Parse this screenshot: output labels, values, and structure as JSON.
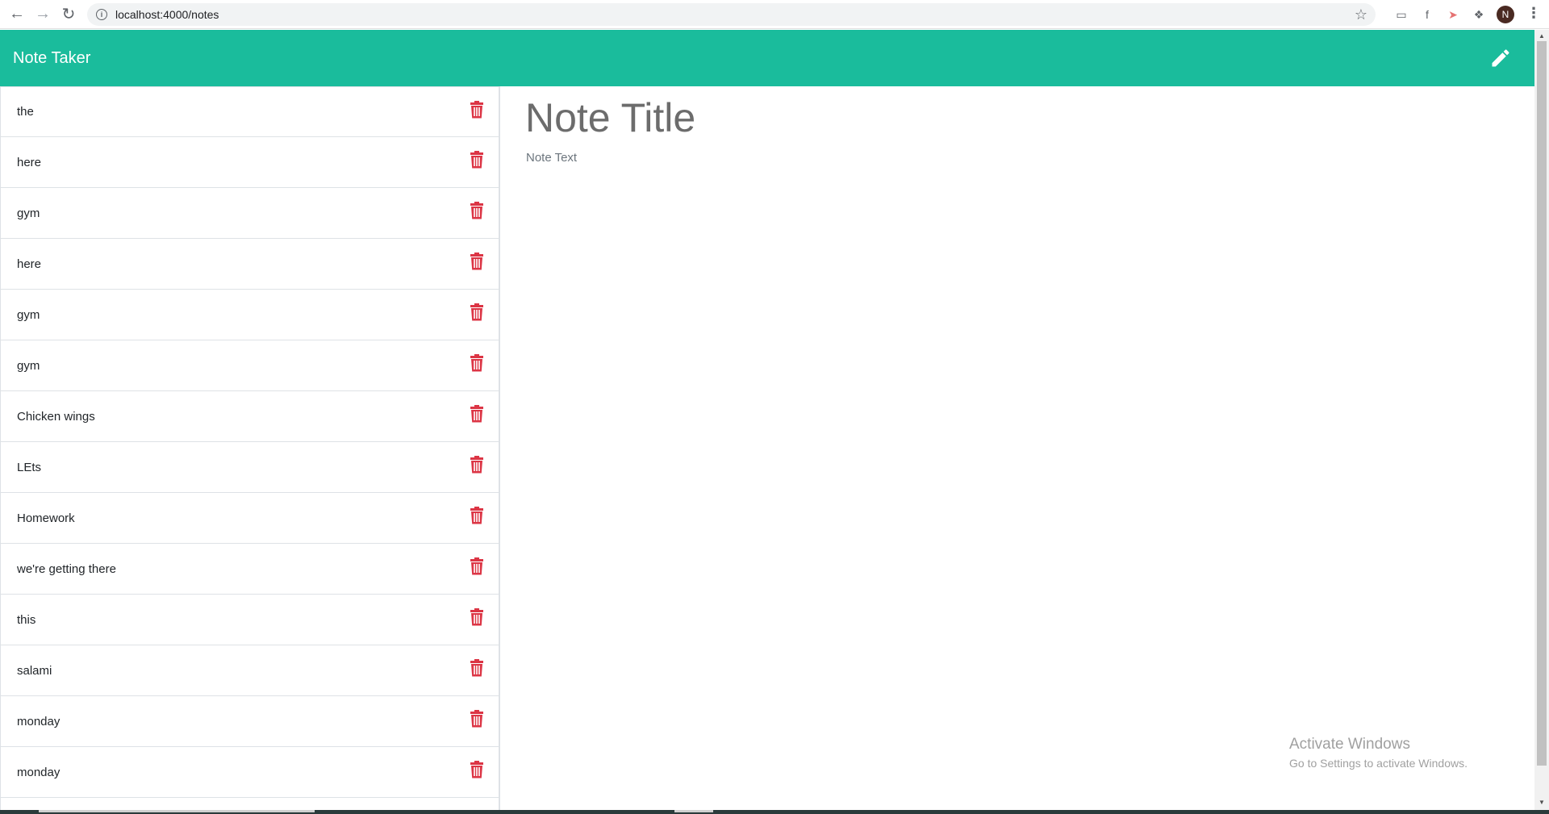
{
  "browser": {
    "url": "localhost:4000/notes",
    "back_icon": "arrow-left-icon",
    "forward_icon": "arrow-right-icon",
    "reload_icon": "reload-icon",
    "avatar_letter": "N"
  },
  "app": {
    "brand": "Note Taker",
    "accent_color": "#1abc9c",
    "delete_color": "#dc3545"
  },
  "notes": [
    {
      "title": "the"
    },
    {
      "title": "here"
    },
    {
      "title": "gym"
    },
    {
      "title": "here"
    },
    {
      "title": "gym"
    },
    {
      "title": "gym"
    },
    {
      "title": "Chicken wings"
    },
    {
      "title": "LEts"
    },
    {
      "title": "Homework"
    },
    {
      "title": "we're getting there"
    },
    {
      "title": "this"
    },
    {
      "title": "salami"
    },
    {
      "title": "monday"
    },
    {
      "title": "monday"
    }
  ],
  "editor": {
    "title_placeholder": "Note Title",
    "text_placeholder": "Note Text"
  },
  "watermark": {
    "line1": "Activate Windows",
    "line2": "Go to Settings to activate Windows."
  }
}
